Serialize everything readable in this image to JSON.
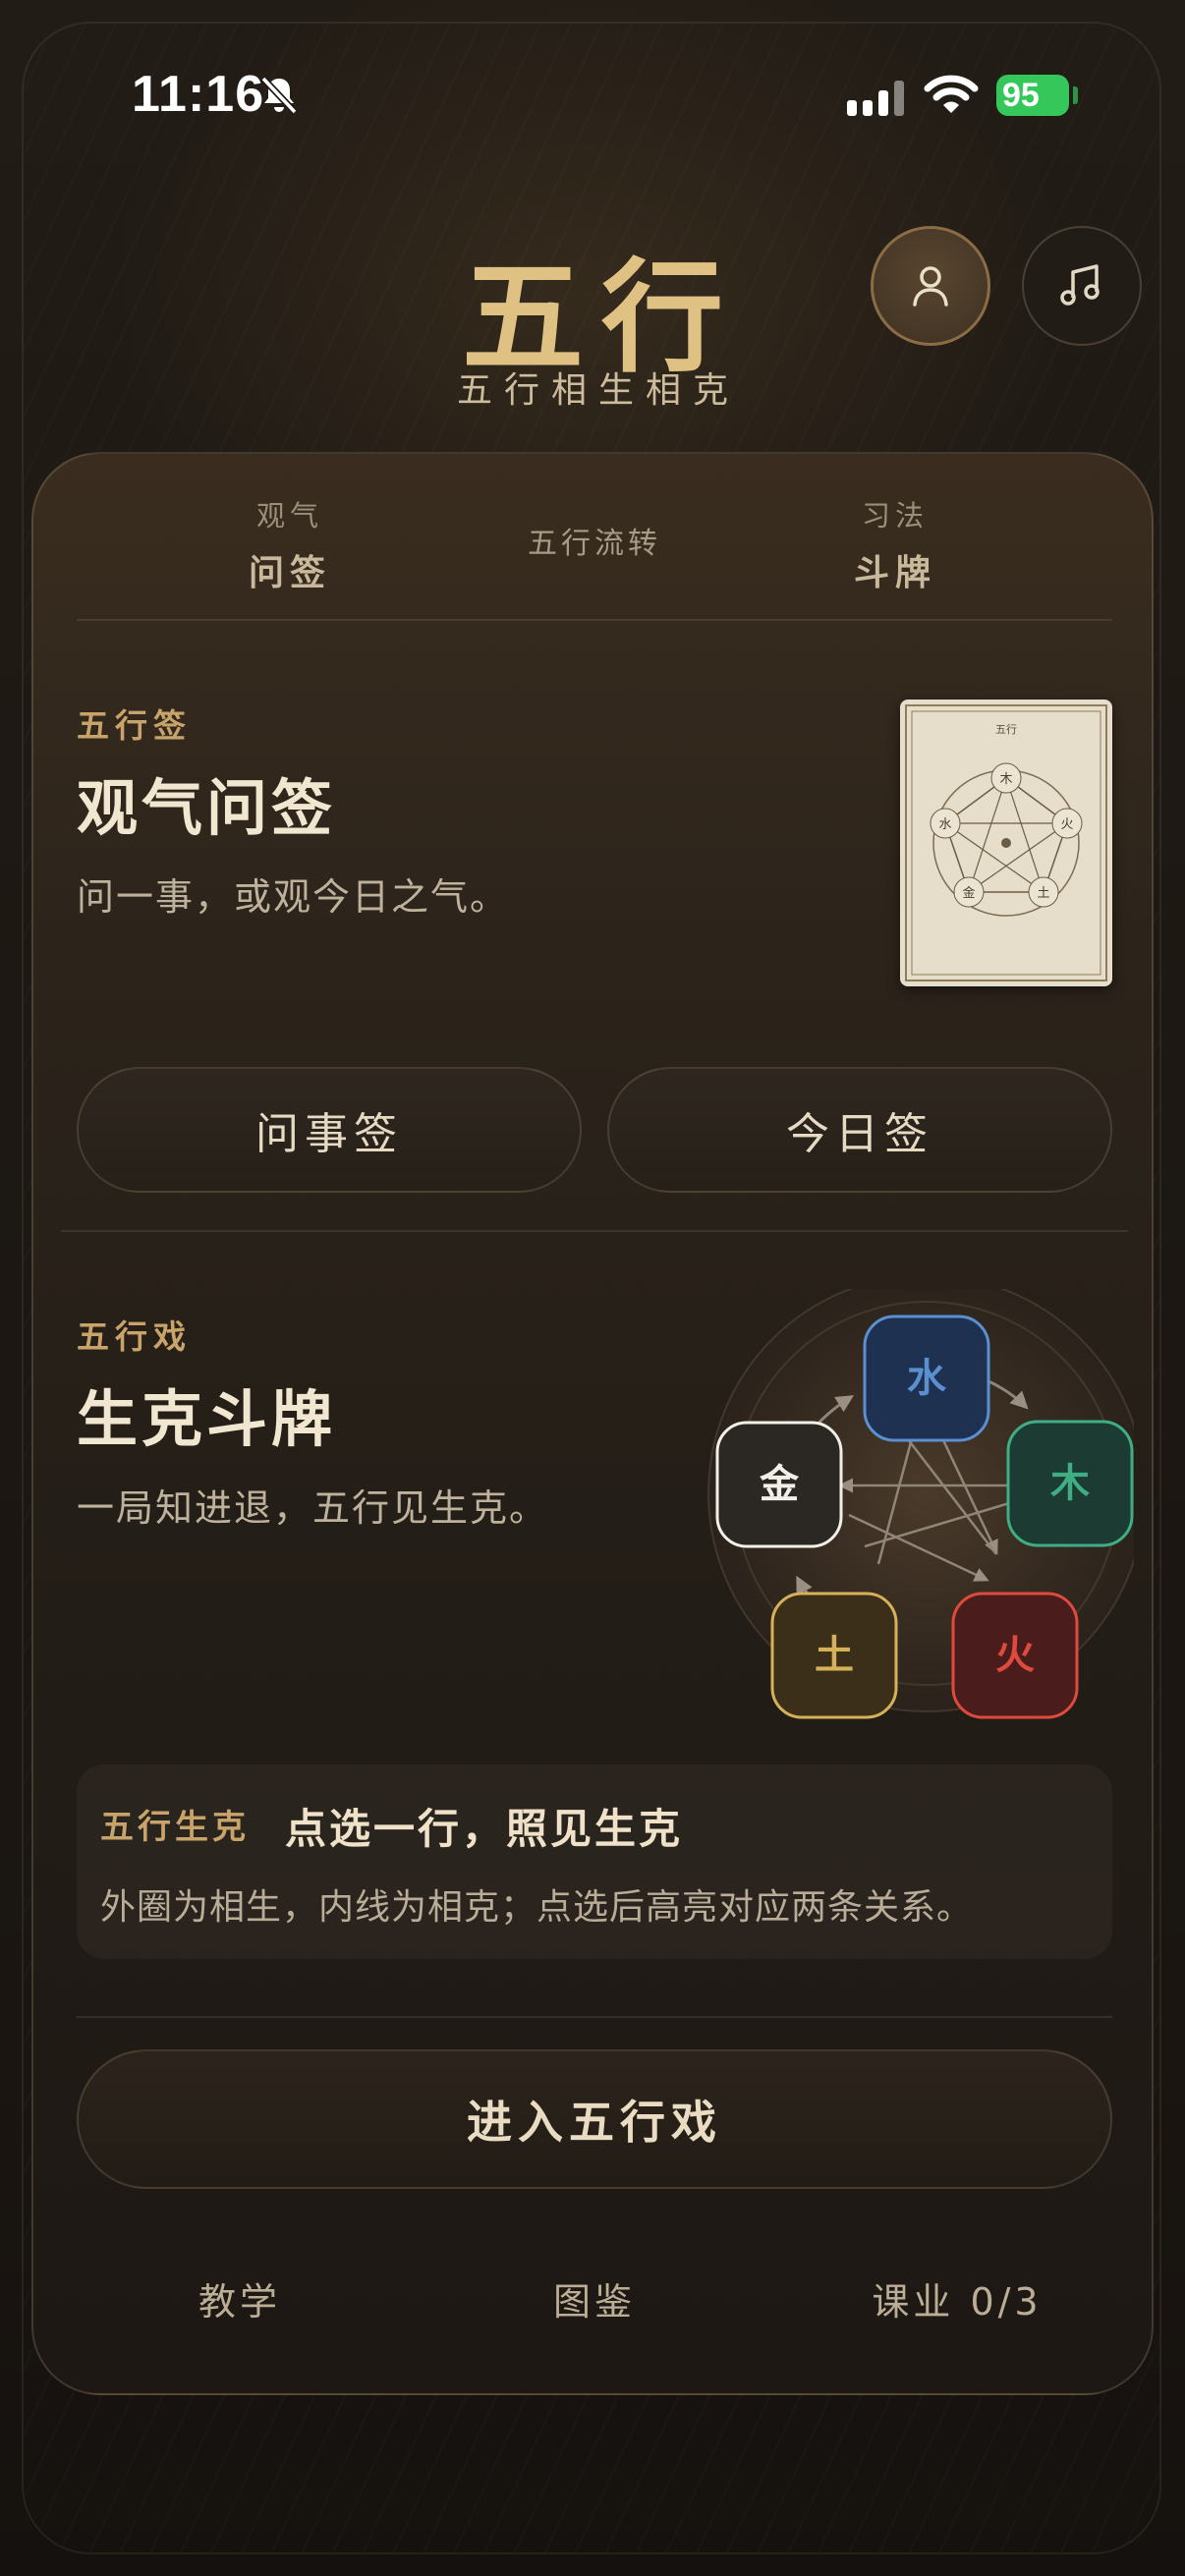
{
  "status_bar": {
    "time": "11:16",
    "battery": "95"
  },
  "header": {
    "title": "五行",
    "subtitle": "五行相生相克"
  },
  "icons": {
    "profile": "person-icon",
    "music": "music-note-icon",
    "bell": "bell-slash-icon",
    "signal": "cellular-signal-icon",
    "wifi": "wifi-icon"
  },
  "tabs": [
    {
      "small": "观气",
      "label": "问签"
    },
    {
      "label": "五行流转"
    },
    {
      "small": "习法",
      "label": "斗牌"
    }
  ],
  "qian": {
    "eyebrow": "五行签",
    "title": "观气问签",
    "desc": "问一事，或观今日之气。",
    "buttons": [
      "问事签",
      "今日签"
    ],
    "card_image_label": "五行",
    "card_nodes": [
      "木",
      "火",
      "土",
      "金",
      "水"
    ]
  },
  "game": {
    "eyebrow": "五行戏",
    "title": "生克斗牌",
    "desc": "一局知进退，五行见生克。",
    "elements": [
      {
        "name": "水",
        "color": "#5a8fd0"
      },
      {
        "name": "木",
        "color": "#3fae85"
      },
      {
        "name": "火",
        "color": "#e04a3e"
      },
      {
        "name": "土",
        "color": "#d6b15a"
      },
      {
        "name": "金",
        "color": "#f2efe8"
      }
    ]
  },
  "hint": {
    "tag": "五行生克",
    "title": "点选一行，照见生克",
    "desc": "外圈为相生，内线为相克；点选后高亮对应两条关系。"
  },
  "enter_button": "进入五行戏",
  "footer": [
    "教学",
    "图鉴",
    "课业 0/3"
  ],
  "colors": {
    "accent_gold": "#e0c184",
    "background": "#1d1813"
  }
}
